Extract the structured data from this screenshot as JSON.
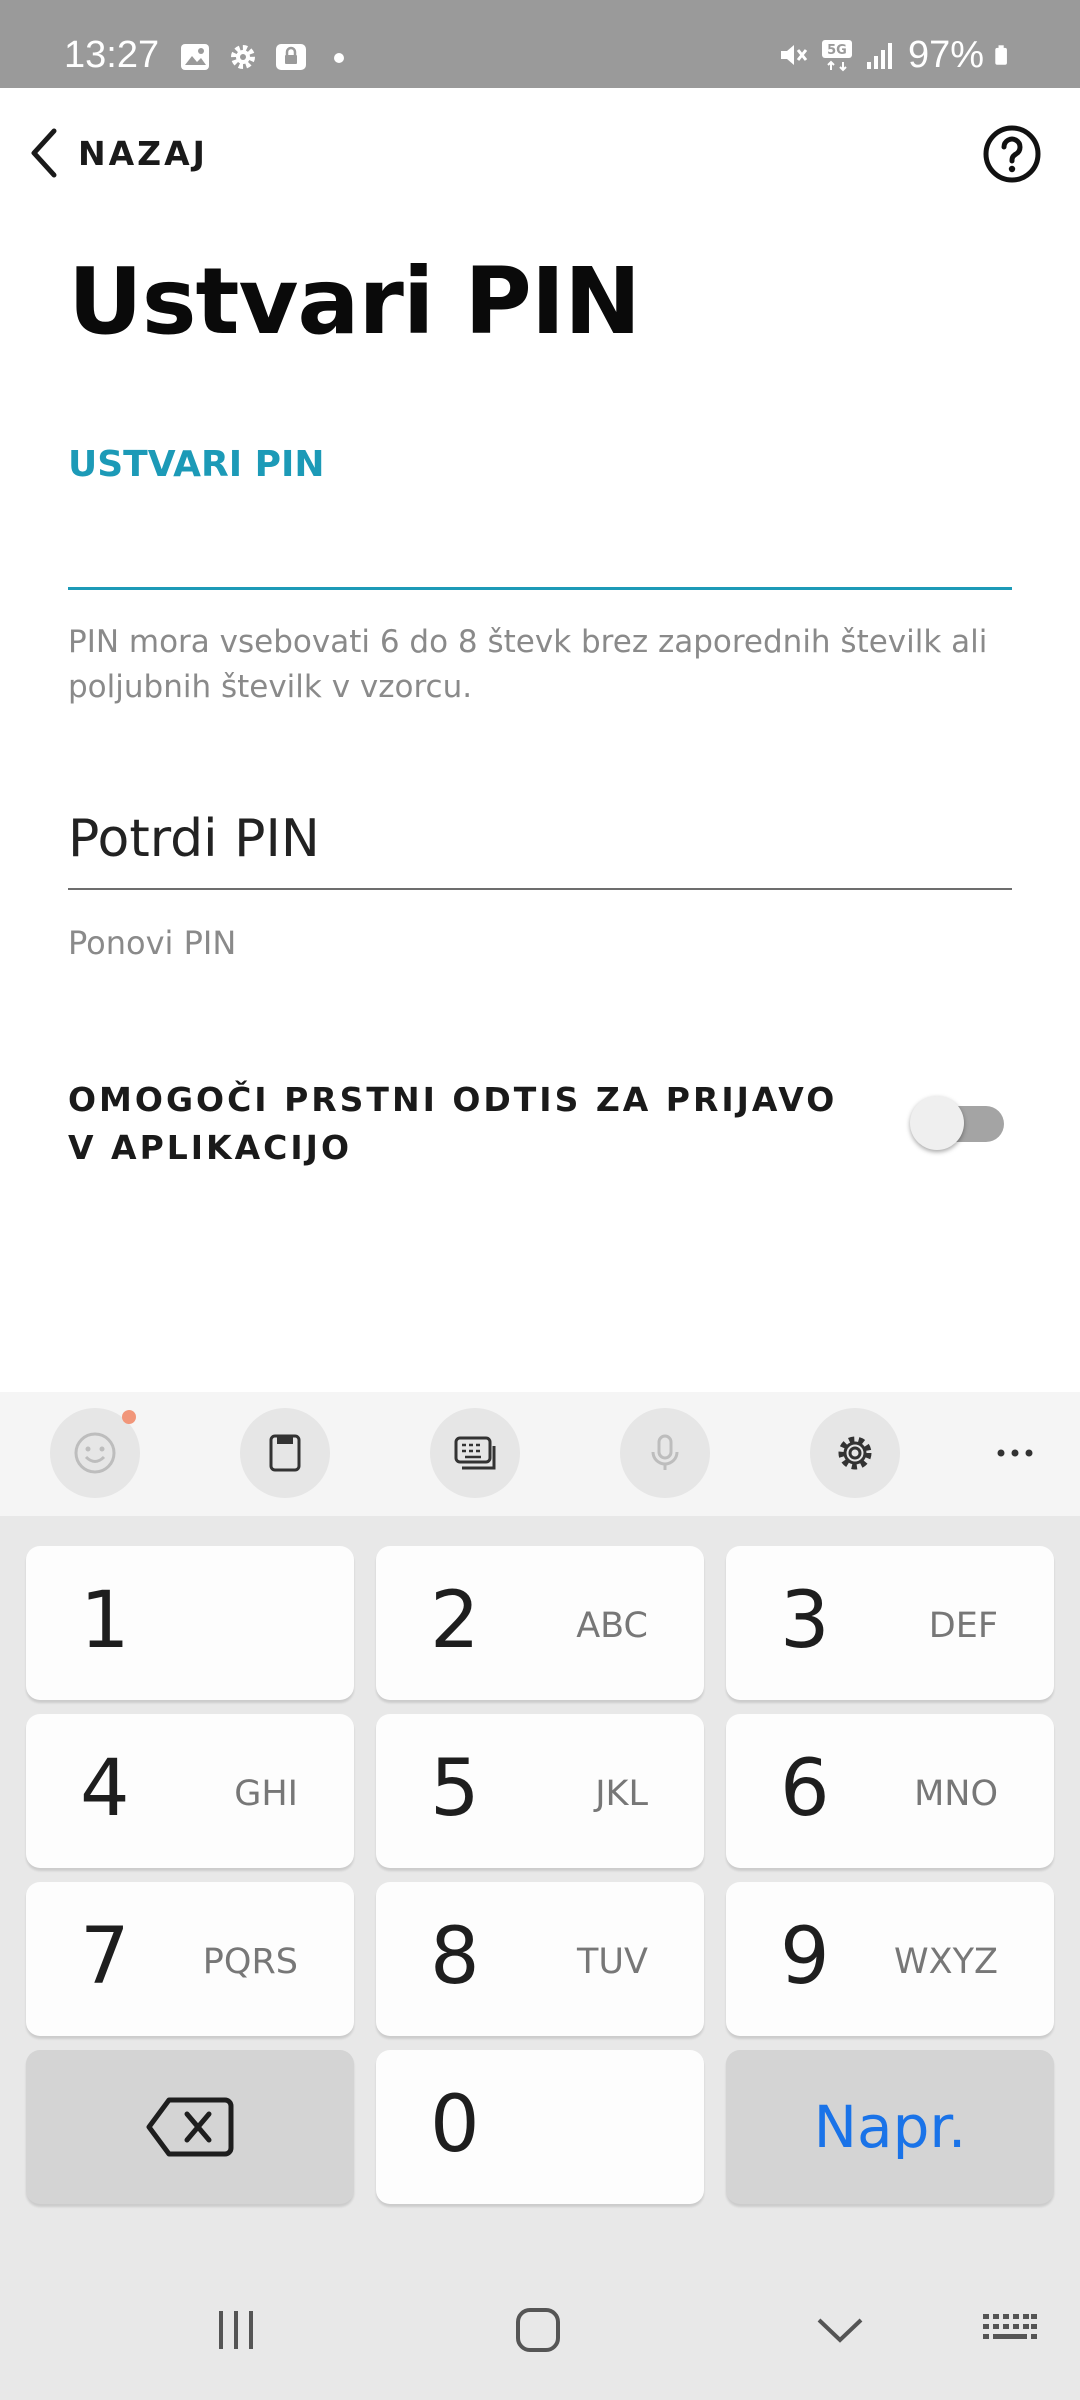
{
  "status_bar": {
    "time": "13:27",
    "battery": "97%",
    "left_icons": [
      "gallery-icon",
      "settings-icon",
      "lock-app-icon",
      "dot-icon"
    ],
    "right_icons": [
      "mute-icon",
      "5g-icon",
      "signal-icon",
      "battery-icon"
    ]
  },
  "header": {
    "back_label": "NAZAJ",
    "help_icon": "question-circle-icon"
  },
  "page": {
    "title": "Ustvari PIN",
    "pin_field": {
      "label": "USTVARI PIN",
      "value": "",
      "helper": "PIN mora vsebovati 6 do 8 števk brez zaporednih številk ali poljubnih številk v vzorcu."
    },
    "confirm_field": {
      "placeholder": "Potrdi PIN",
      "value": "",
      "helper": "Ponovi PIN"
    },
    "fingerprint": {
      "label": "OMOGOČI PRSTNI ODTIS ZA PRIJAVO V APLIKACIJO",
      "enabled": false
    }
  },
  "keyboard": {
    "toolbar": [
      "emoji-icon",
      "clipboard-icon",
      "keyboard-mode-icon",
      "microphone-icon",
      "gear-icon",
      "more-icon"
    ],
    "keys": [
      {
        "num": "1",
        "letters": ""
      },
      {
        "num": "2",
        "letters": "ABC"
      },
      {
        "num": "3",
        "letters": "DEF"
      },
      {
        "num": "4",
        "letters": "GHI"
      },
      {
        "num": "5",
        "letters": "JKL"
      },
      {
        "num": "6",
        "letters": "MNO"
      },
      {
        "num": "7",
        "letters": "PQRS"
      },
      {
        "num": "8",
        "letters": "TUV"
      },
      {
        "num": "9",
        "letters": "WXYZ"
      },
      {
        "num": "0",
        "letters": ""
      }
    ],
    "go_label": "Napr.",
    "accent": "#1a73e8"
  },
  "nav_bar": [
    "recents-icon",
    "home-icon",
    "hide-keyboard-icon",
    "keyboard-switch-icon"
  ],
  "colors": {
    "accent": "#1c9ab7",
    "status_bar": "#9a9a9a"
  }
}
